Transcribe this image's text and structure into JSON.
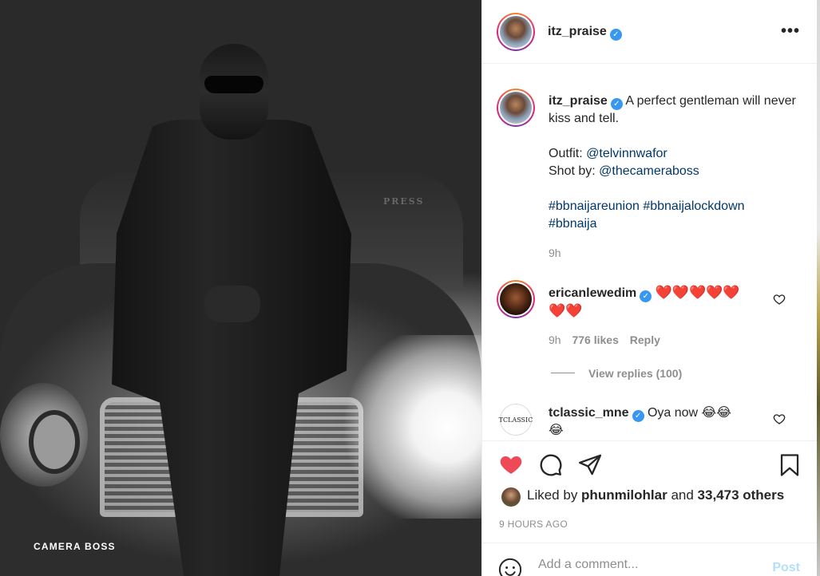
{
  "photo": {
    "watermark": "CAMERA BOSS",
    "car_plate_text": "PRESS"
  },
  "post": {
    "author": "itz_praise",
    "caption": {
      "username": "itz_praise",
      "text": "A perfect gentleman will never kiss and tell.",
      "outfit_label": "Outfit: ",
      "outfit_handle": "@telvinnwafor",
      "shot_label": "Shot by: ",
      "shot_handle": "@thecameraboss",
      "hashtags_line1": "#bbnaijareunion #bbnaijalockdown",
      "hashtags_line2": "#bbnaija",
      "time": "9h"
    },
    "comments": [
      {
        "username": "ericanlewedim",
        "hearts_line1": "❤️❤️❤️❤️❤️",
        "hearts_line2": "❤️❤️",
        "time": "9h",
        "likes": "776 likes",
        "reply": "Reply",
        "view_replies": "View replies (100)"
      },
      {
        "username": "tclassic_mne",
        "avatar_text": "TCLASSIC",
        "text": "Oya now 😂😂",
        "text_line2": "😂"
      }
    ],
    "liked_by": {
      "prefix": "Liked by ",
      "user": "phunmilohlar",
      "and": " and ",
      "others": "33,473 others"
    },
    "timestamp": "9 HOURS AGO",
    "comment_placeholder": "Add a comment...",
    "post_button": "Post"
  },
  "colors": {
    "like_red": "#ed4956",
    "link_blue": "#00376b",
    "verified_blue": "#3897f0",
    "post_button_disabled": "#b2dffc"
  },
  "icons": [
    "more-icon",
    "verified-icon",
    "heart-icon",
    "comment-icon",
    "share-icon",
    "bookmark-icon",
    "emoji-icon"
  ]
}
